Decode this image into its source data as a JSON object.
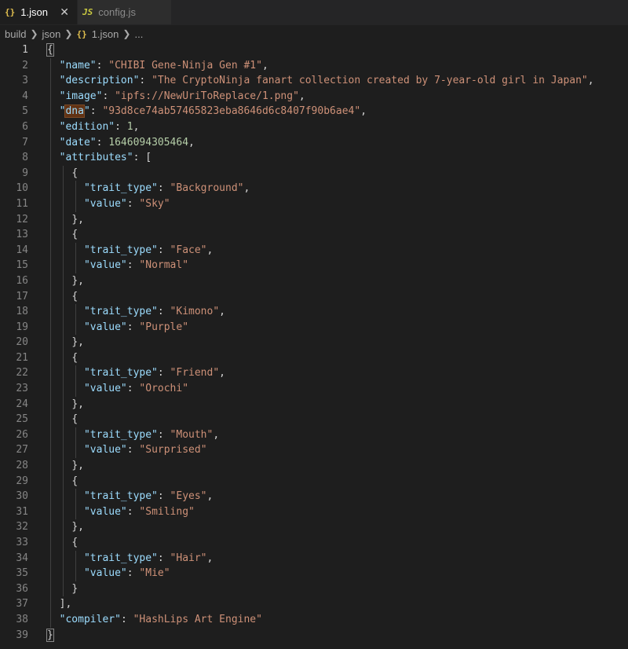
{
  "tabs": [
    {
      "label": "1.json",
      "icon": "{}",
      "active": true
    },
    {
      "label": "config.js",
      "icon": "JS",
      "active": false
    }
  ],
  "breadcrumb": [
    "build",
    "json",
    "1.json",
    "..."
  ],
  "breadcrumb_icon": "{}",
  "code": {
    "name_key": "\"name\"",
    "name_val": "\"CHIBI Gene-Ninja Gen #1\"",
    "description_key": "\"description\"",
    "description_val": "\"The CryptoNinja fanart collection created by 7-year-old girl in Japan\"",
    "image_key": "\"image\"",
    "image_val": "\"ipfs://NewUriToReplace/1.png\"",
    "dna_key_pre": "\"",
    "dna_key_word": "dna",
    "dna_key_post": "\"",
    "dna_val": "\"93d8ce74ab57465823eba8646d6c8407f90b6ae4\"",
    "edition_key": "\"edition\"",
    "edition_val": "1",
    "date_key": "\"date\"",
    "date_val": "1646094305464",
    "attributes_key": "\"attributes\"",
    "trait_key": "\"trait_type\"",
    "value_key": "\"value\"",
    "attributes": [
      {
        "trait_type": "\"Background\"",
        "value": "\"Sky\""
      },
      {
        "trait_type": "\"Face\"",
        "value": "\"Normal\""
      },
      {
        "trait_type": "\"Kimono\"",
        "value": "\"Purple\""
      },
      {
        "trait_type": "\"Friend\"",
        "value": "\"Orochi\""
      },
      {
        "trait_type": "\"Mouth\"",
        "value": "\"Surprised\""
      },
      {
        "trait_type": "\"Eyes\"",
        "value": "\"Smiling\""
      },
      {
        "trait_type": "\"Hair\"",
        "value": "\"Mie\""
      }
    ],
    "compiler_key": "\"compiler\"",
    "compiler_val": "\"HashLips Art Engine\""
  },
  "line_numbers": [
    "1",
    "2",
    "3",
    "4",
    "5",
    "6",
    "7",
    "8",
    "9",
    "10",
    "11",
    "12",
    "13",
    "14",
    "15",
    "16",
    "17",
    "18",
    "19",
    "20",
    "21",
    "22",
    "23",
    "24",
    "25",
    "26",
    "27",
    "28",
    "29",
    "30",
    "31",
    "32",
    "33",
    "34",
    "35",
    "36",
    "37",
    "38",
    "39"
  ],
  "colors": {
    "key": "#9cdcfe",
    "string": "#ce9178",
    "number": "#b5cea8",
    "json_icon": "#e2c04f",
    "js_icon": "#cbcb41"
  }
}
